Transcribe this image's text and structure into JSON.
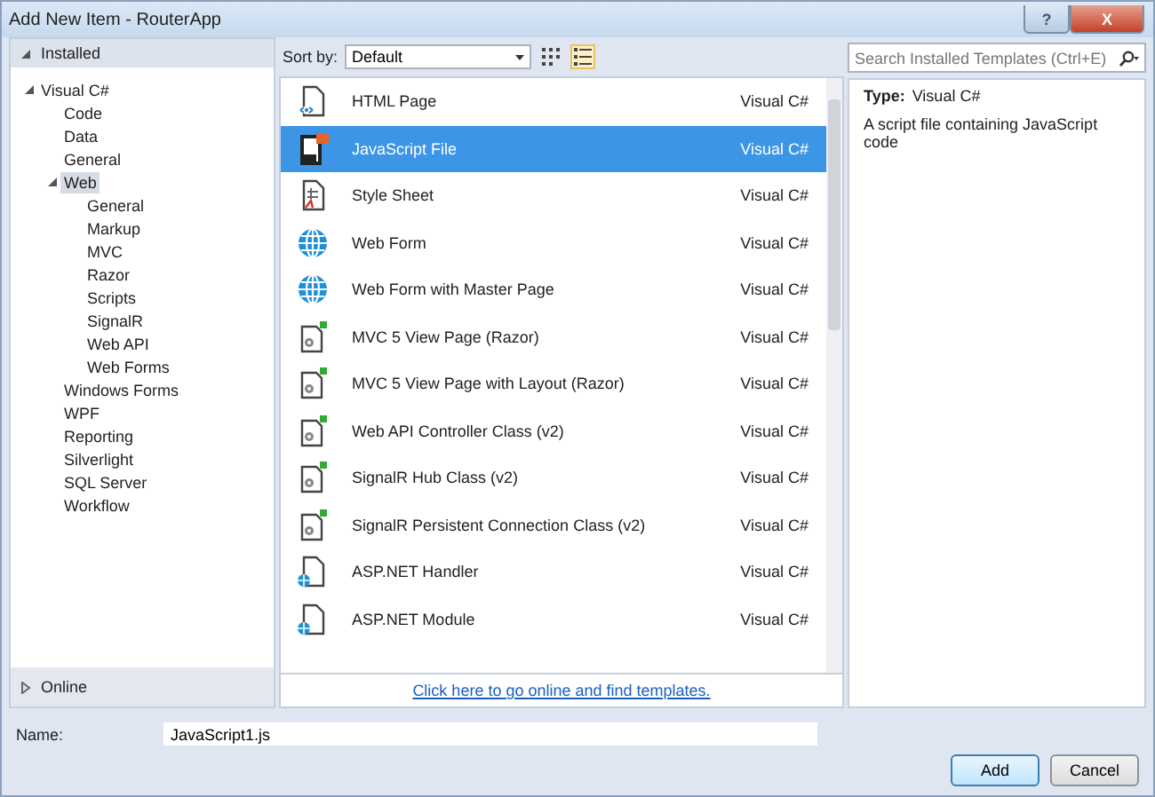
{
  "window": {
    "title": "Add New Item - RouterApp",
    "help_button": "?",
    "close_button": "X"
  },
  "sidebar": {
    "sections": [
      {
        "label": "Installed",
        "expanded": true,
        "tree": [
          {
            "label": "Visual C#",
            "expanded": true,
            "selected": false,
            "children": [
              {
                "label": "Code",
                "selected": false
              },
              {
                "label": "Data",
                "selected": false
              },
              {
                "label": "General",
                "selected": false
              },
              {
                "label": "Web",
                "expanded": true,
                "selected": true,
                "children": [
                  {
                    "label": "General",
                    "selected": false
                  },
                  {
                    "label": "Markup",
                    "selected": false
                  },
                  {
                    "label": "MVC",
                    "selected": false
                  },
                  {
                    "label": "Razor",
                    "selected": false
                  },
                  {
                    "label": "Scripts",
                    "selected": false
                  },
                  {
                    "label": "SignalR",
                    "selected": false
                  },
                  {
                    "label": "Web API",
                    "selected": false
                  },
                  {
                    "label": "Web Forms",
                    "selected": false
                  }
                ]
              },
              {
                "label": "Windows Forms",
                "selected": false
              },
              {
                "label": "WPF",
                "selected": false
              },
              {
                "label": "Reporting",
                "selected": false
              },
              {
                "label": "Silverlight",
                "selected": false
              },
              {
                "label": "SQL Server",
                "selected": false
              },
              {
                "label": "Workflow",
                "selected": false
              }
            ]
          }
        ]
      },
      {
        "label": "Online",
        "expanded": false
      }
    ]
  },
  "toolbar": {
    "sort_label": "Sort by:",
    "sort_value": "Default",
    "views": [
      {
        "kind": "grid",
        "selected": false
      },
      {
        "kind": "list",
        "selected": true
      }
    ]
  },
  "templates": [
    {
      "kind": "page",
      "name": "HTML Page",
      "language": "Visual C#",
      "selected": false
    },
    {
      "kind": "js",
      "name": "JavaScript File",
      "language": "Visual C#",
      "selected": true
    },
    {
      "kind": "css",
      "name": "Style Sheet",
      "language": "Visual C#",
      "selected": false
    },
    {
      "kind": "globe",
      "name": "Web Form",
      "language": "Visual C#",
      "selected": false
    },
    {
      "kind": "globe",
      "name": "Web Form with Master Page",
      "language": "Visual C#",
      "selected": false
    },
    {
      "kind": "class",
      "name": "MVC 5 View Page (Razor)",
      "language": "Visual C#",
      "selected": false
    },
    {
      "kind": "class",
      "name": "MVC 5 View Page with Layout (Razor)",
      "language": "Visual C#",
      "selected": false
    },
    {
      "kind": "class",
      "name": "Web API Controller Class (v2)",
      "language": "Visual C#",
      "selected": false
    },
    {
      "kind": "class",
      "name": "SignalR Hub Class (v2)",
      "language": "Visual C#",
      "selected": false
    },
    {
      "kind": "class",
      "name": "SignalR Persistent Connection Class (v2)",
      "language": "Visual C#",
      "selected": false
    },
    {
      "kind": "aspnet",
      "name": "ASP.NET Handler",
      "language": "Visual C#",
      "selected": false
    },
    {
      "kind": "aspnet",
      "name": "ASP.NET Module",
      "language": "Visual C#",
      "selected": false
    }
  ],
  "online_link": "Click here to go online and find templates.",
  "search": {
    "placeholder": "Search Installed Templates (Ctrl+E)"
  },
  "details": {
    "type_label": "Type:",
    "type_value": "Visual C#",
    "description": "A script file containing JavaScript code"
  },
  "name_field": {
    "label": "Name:",
    "value": "JavaScript1.js"
  },
  "buttons": [
    {
      "label": "Add",
      "default": true
    },
    {
      "label": "Cancel",
      "default": false
    }
  ]
}
